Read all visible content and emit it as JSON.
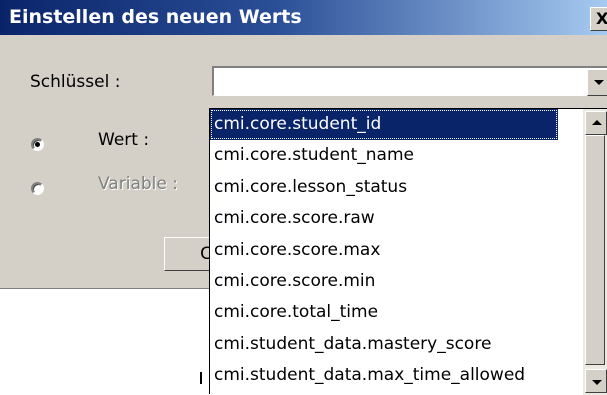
{
  "dialog": {
    "title": "Einstellen des neuen Werts",
    "close_label": "X",
    "key_label": "Schlüssel :",
    "key_value": "",
    "value_radio_label": "Wert :",
    "value_radio_checked": true,
    "variable_radio_label": "Variable :",
    "variable_radio_checked": false,
    "partial_button_label": "C"
  },
  "dropdown": {
    "items": [
      "cmi.core.student_id",
      "cmi.core.student_name",
      "cmi.core.lesson_status",
      "cmi.core.score.raw",
      "cmi.core.score.max",
      "cmi.core.score.min",
      "cmi.core.total_time",
      "cmi.student_data.mastery_score",
      "cmi.student_data.max_time_allowed"
    ],
    "selected_index": 0
  },
  "colors": {
    "titlebar": "#0a246a",
    "selection": "#0a246a",
    "dialog_bg": "#d4d0c8"
  }
}
